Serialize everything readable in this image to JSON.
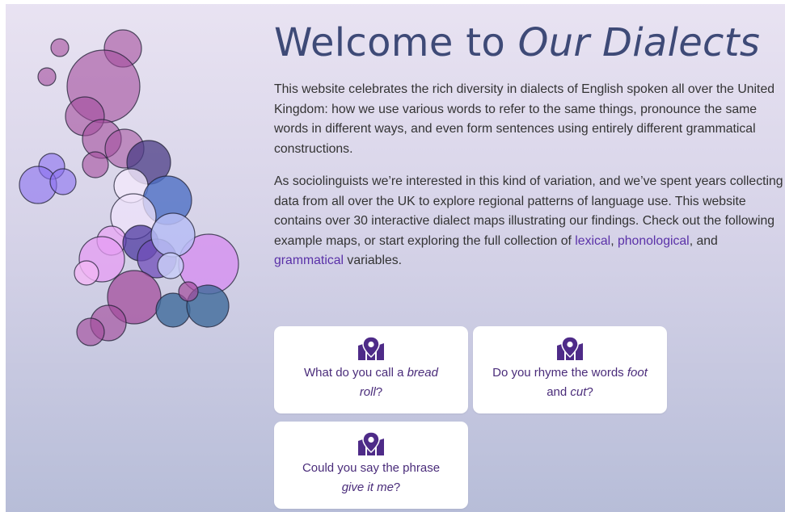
{
  "header": {
    "title_plain": "Welcome to ",
    "title_italic": "Our Dialects"
  },
  "intro": {
    "p1": "This website celebrates the rich diversity in dialects of English spoken all over the United Kingdom: how we use various words to refer to the same things, pronounce the same words in different ways, and even form sentences using entirely different grammatical constructions.",
    "p2_lead": "As sociolinguists we’re interested in this kind of variation, and we’ve spent years collecting data from all over the UK to explore regional patterns of language use. This website contains over 30 interactive dialect maps illustrating our findings. Check out the following example maps, or start exploring the full collection of ",
    "link_lexical": "lexical",
    "sep_comma": ", ",
    "link_phonological": "phonological",
    "sep_and": ", and ",
    "link_grammatical": "grammatical",
    "p2_tail": " variables."
  },
  "cards": [
    {
      "icon": "map-pin-icon",
      "t1": "What do you call a ",
      "em1": "bread roll",
      "t2": "?"
    },
    {
      "icon": "map-pin-icon",
      "t1": "Do you rhyme the words ",
      "em1": "foot",
      "t2": " and ",
      "em2": "cut",
      "t3": "?"
    },
    {
      "icon": "map-pin-icon",
      "t1": "Could you say the phrase ",
      "em1": "give it me",
      "t2": "?"
    }
  ],
  "colors": {
    "title": "#3e4a77",
    "link": "#5a31a8",
    "icon": "#4e2b88",
    "bubble_magenta": "#a34d9c",
    "bubble_violet": "#7b6fe0",
    "bubble_blue": "#4d6fc4",
    "bubble_steel": "#3f6a9a",
    "bubble_pink": "#d58bf0"
  },
  "illustration": {
    "name": "dialect-bubble-map-of-uk"
  }
}
